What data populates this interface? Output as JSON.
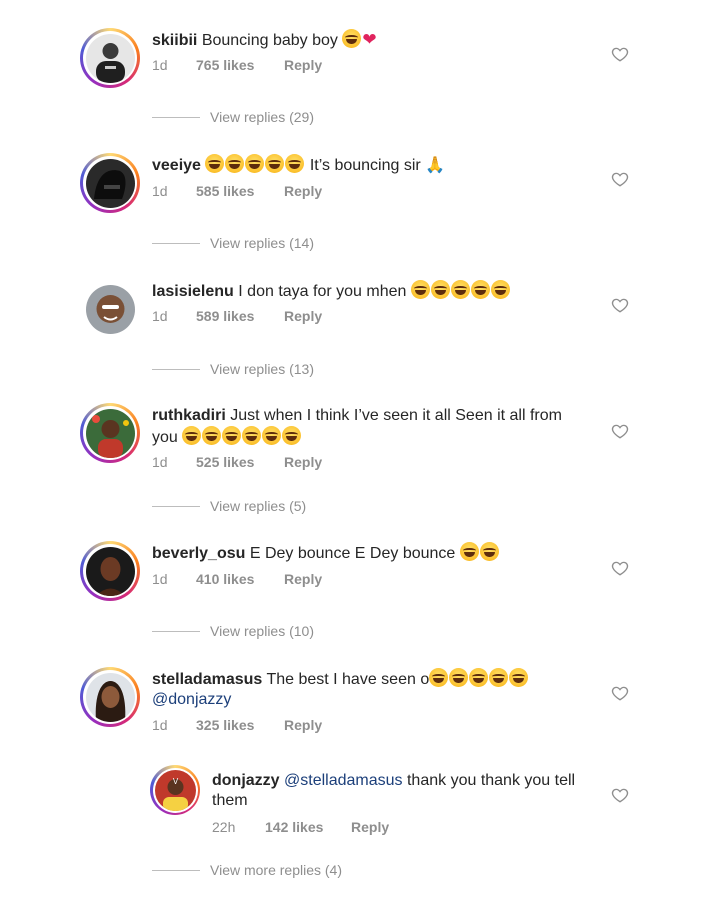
{
  "comments": [
    {
      "username": "skiibii",
      "text": "Bouncing baby boy",
      "time": "1d",
      "likes": "765 likes",
      "reply": "Reply",
      "view_replies": "View replies (29)"
    },
    {
      "username": "veeiye",
      "text": "It’s bouncing sir",
      "time": "1d",
      "likes": "585 likes",
      "reply": "Reply",
      "view_replies": "View replies (14)"
    },
    {
      "username": "lasisielenu",
      "text": "I don taya for you mhen",
      "time": "1d",
      "likes": "589 likes",
      "reply": "Reply",
      "view_replies": "View replies (13)"
    },
    {
      "username": "ruthkadiri",
      "text": "Just when I think I’ve seen it all Seen it all from",
      "text2": "you",
      "time": "1d",
      "likes": "525 likes",
      "reply": "Reply",
      "view_replies": "View replies (5)"
    },
    {
      "username": "beverly_osu",
      "text": "E Dey bounce E Dey bounce",
      "time": "1d",
      "likes": "410 likes",
      "reply": "Reply",
      "view_replies": "View replies (10)"
    },
    {
      "username": "stelladamasus",
      "text": "The best I have seen o",
      "mention": "@donjazzy",
      "time": "1d",
      "likes": "325 likes",
      "reply": "Reply"
    }
  ],
  "nested_reply": {
    "username": "donjazzy",
    "mention": "@stelladamasus",
    "text": "thank you thank you tell",
    "text2": "them",
    "time": "22h",
    "likes": "142 likes",
    "reply": "Reply"
  },
  "view_more_replies": "View more replies (4)",
  "icons": {
    "like": "heart-outline-icon",
    "emoji_laugh": "tears-of-joy-emoji",
    "emoji_cry": "loudly-crying-emoji",
    "emoji_pray": "folded-hands-emoji",
    "emoji_heart": "red-heart-emoji"
  },
  "colors": {
    "ring_start": "#feda75",
    "ring_end": "#962fbf",
    "meta": "#8e8e8e",
    "mention": "#1c3f7a"
  }
}
